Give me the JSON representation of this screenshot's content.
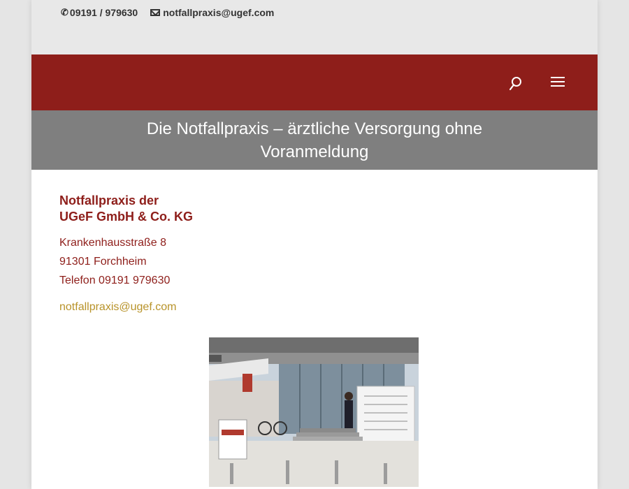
{
  "topbar": {
    "phone": "09191 / 979630",
    "email": "notfallpraxis@ugef.com"
  },
  "hero": {
    "title": "Die Notfallpraxis – ärztliche Versorgung ohne Voranmeldung"
  },
  "address_block": {
    "org_line1": "Notfallpraxis der",
    "org_line2": "UGeF GmbH & Co. KG",
    "street": "Krankenhausstraße 8",
    "city": "91301 Forchheim",
    "phone": "Telefon 09191 979630",
    "email": "notfallpraxis@ugef.com"
  },
  "colors": {
    "brand_red": "#8e1e1a",
    "hero_gray": "#7f7f7f",
    "link_gold": "#b8932a"
  },
  "icons": [
    "phone-icon",
    "mail-icon",
    "search-icon",
    "hamburger-menu-icon"
  ]
}
